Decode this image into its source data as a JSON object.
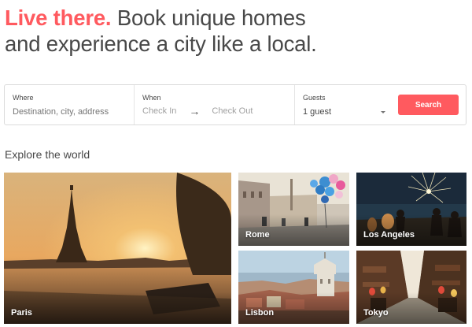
{
  "hero": {
    "accent": "Live there.",
    "line1_rest": "Book unique homes",
    "line2": "and experience a city like a local."
  },
  "search": {
    "where_label": "Where",
    "where_placeholder": "Destination, city, address",
    "when_label": "When",
    "check_in": "Check In",
    "arrow": "→",
    "check_out": "Check Out",
    "guests_label": "Guests",
    "guests_value": "1 guest",
    "button": "Search"
  },
  "explore": {
    "title": "Explore the world",
    "cities": [
      "Paris",
      "Rome",
      "Los Angeles",
      "Lisbon",
      "Tokyo"
    ]
  },
  "colors": {
    "brand": "#ff5a5f",
    "text": "#484848"
  }
}
